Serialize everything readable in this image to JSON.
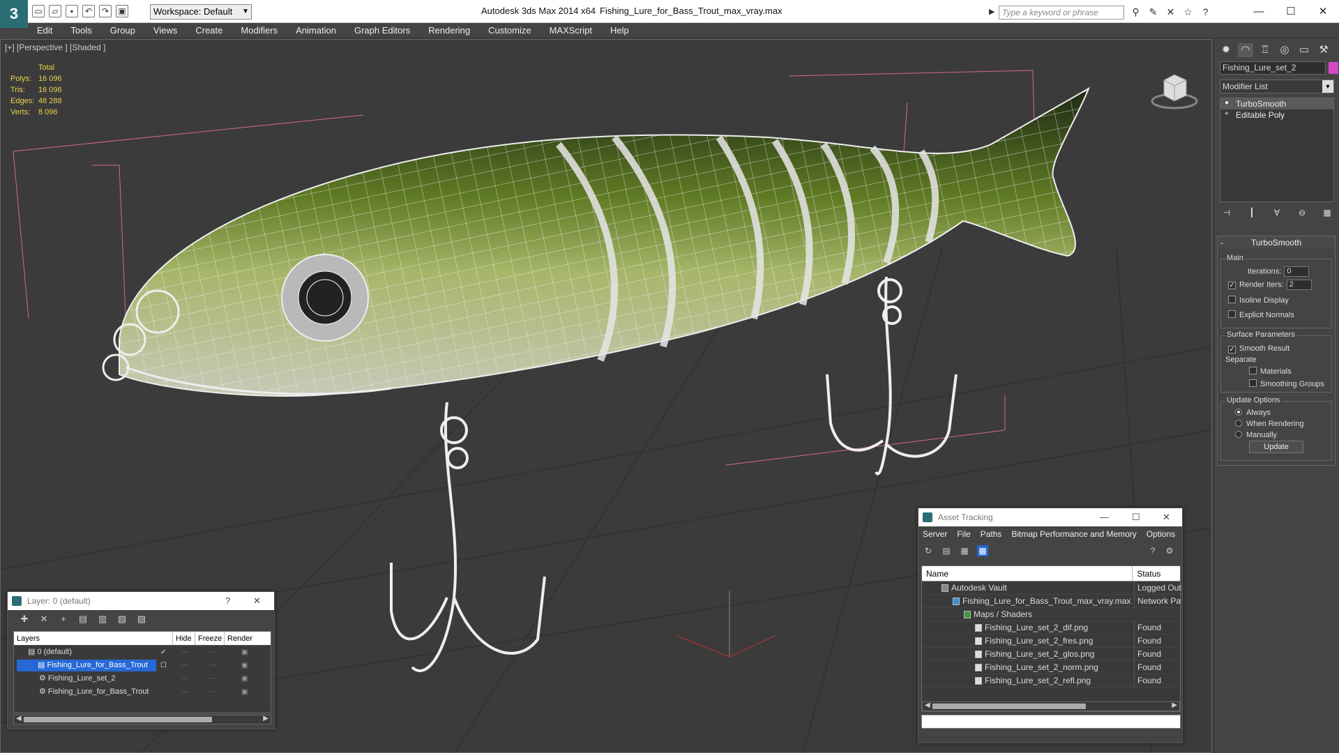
{
  "app": {
    "title": "Autodesk 3ds Max  2014 x64",
    "file": "Fishing_Lure_for_Bass_Trout_max_vray.max",
    "workspace": "Workspace: Default",
    "search_placeholder": "Type a keyword or phrase"
  },
  "menu": [
    "Edit",
    "Tools",
    "Group",
    "Views",
    "Create",
    "Modifiers",
    "Animation",
    "Graph Editors",
    "Rendering",
    "Customize",
    "MAXScript",
    "Help"
  ],
  "viewport": {
    "label": "[+] [Perspective ] [Shaded ]",
    "stats": {
      "header": "Total",
      "rows": [
        {
          "k": "Polys:",
          "v": "16 096"
        },
        {
          "k": "Tris:",
          "v": "16 096"
        },
        {
          "k": "Edges:",
          "v": "48 288"
        },
        {
          "k": "Verts:",
          "v": "8 096"
        }
      ]
    }
  },
  "command_panel": {
    "object_name": "Fishing_Lure_set_2",
    "object_color": "#d24ac6",
    "modifier_list": "Modifier List",
    "stack": [
      "TurboSmooth",
      "Editable Poly"
    ],
    "rollout_title": "TurboSmooth",
    "main_group": "Main",
    "iterations_label": "Iterations:",
    "iterations_value": "0",
    "render_iters_label": "Render Iters:",
    "render_iters_value": "2",
    "isoline": "Isoline Display",
    "explicit_normals": "Explicit Normals",
    "surface_group": "Surface Parameters",
    "smooth_result": "Smooth Result",
    "separate": "Separate",
    "materials": "Materials",
    "smoothing_groups": "Smoothing Groups",
    "update_group": "Update Options",
    "always": "Always",
    "when_rendering": "When Rendering",
    "manually": "Manually",
    "update_button": "Update"
  },
  "layer_window": {
    "title": "Layer: 0 (default)",
    "help": "?",
    "columns": [
      "Layers",
      "Hide",
      "Freeze",
      "Render"
    ],
    "rows": [
      "0 (default)",
      "Fishing_Lure_for_Bass_Trout",
      "Fishing_Lure_set_2",
      "Fishing_Lure_for_Bass_Trout"
    ]
  },
  "asset_window": {
    "title": "Asset Tracking",
    "menu": [
      "Server",
      "File",
      "Paths",
      "Bitmap Performance and Memory",
      "Options"
    ],
    "columns": [
      "Name",
      "Status"
    ],
    "rows": [
      {
        "name": "Autodesk Vault",
        "status": "Logged Out"
      },
      {
        "name": "Fishing_Lure_for_Bass_Trout_max_vray.max",
        "status": "Network Pat"
      },
      {
        "name": "Maps / Shaders",
        "status": ""
      },
      {
        "name": "Fishing_Lure_set_2_dif.png",
        "status": "Found"
      },
      {
        "name": "Fishing_Lure_set_2_fres.png",
        "status": "Found"
      },
      {
        "name": "Fishing_Lure_set_2_glos.png",
        "status": "Found"
      },
      {
        "name": "Fishing_Lure_set_2_norm.png",
        "status": "Found"
      },
      {
        "name": "Fishing_Lure_set_2_refl.png",
        "status": "Found"
      }
    ]
  },
  "colors": {
    "accent": "#2668d6",
    "stats_text": "#e8d24a",
    "bbox": "#d46a8a"
  }
}
